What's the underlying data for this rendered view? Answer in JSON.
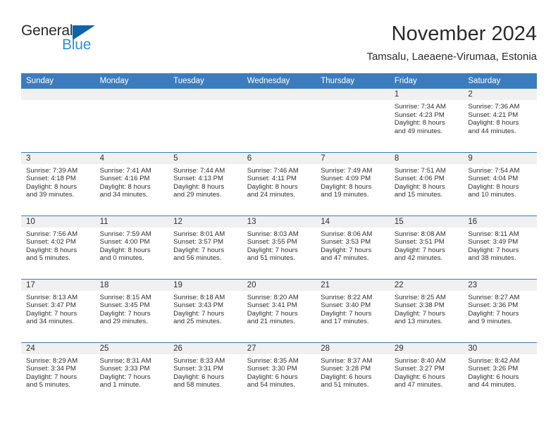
{
  "logo": {
    "word1": "General",
    "word2": "Blue",
    "triangle_color": "#0f64a8",
    "word2_color": "#2f8fd8"
  },
  "header": {
    "title": "November 2024",
    "subtitle": "Tamsalu, Laeaene-Virumaa, Estonia"
  },
  "theme": {
    "header_blue": "#3b7cbe",
    "band_gray": "#f0f0f0",
    "text": "#303030"
  },
  "calendar": {
    "weekday_headers": [
      "Sunday",
      "Monday",
      "Tuesday",
      "Wednesday",
      "Thursday",
      "Friday",
      "Saturday"
    ],
    "weeks": [
      [
        {
          "day": "",
          "empty": true,
          "sunrise": "",
          "sunset": "",
          "daylight1": "",
          "daylight2": ""
        },
        {
          "day": "",
          "empty": true,
          "sunrise": "",
          "sunset": "",
          "daylight1": "",
          "daylight2": ""
        },
        {
          "day": "",
          "empty": true,
          "sunrise": "",
          "sunset": "",
          "daylight1": "",
          "daylight2": ""
        },
        {
          "day": "",
          "empty": true,
          "sunrise": "",
          "sunset": "",
          "daylight1": "",
          "daylight2": ""
        },
        {
          "day": "",
          "empty": true,
          "sunrise": "",
          "sunset": "",
          "daylight1": "",
          "daylight2": ""
        },
        {
          "day": "1",
          "empty": false,
          "sunrise": "Sunrise: 7:34 AM",
          "sunset": "Sunset: 4:23 PM",
          "daylight1": "Daylight: 8 hours",
          "daylight2": "and 49 minutes."
        },
        {
          "day": "2",
          "empty": false,
          "sunrise": "Sunrise: 7:36 AM",
          "sunset": "Sunset: 4:21 PM",
          "daylight1": "Daylight: 8 hours",
          "daylight2": "and 44 minutes."
        }
      ],
      [
        {
          "day": "3",
          "empty": false,
          "sunrise": "Sunrise: 7:39 AM",
          "sunset": "Sunset: 4:18 PM",
          "daylight1": "Daylight: 8 hours",
          "daylight2": "and 39 minutes."
        },
        {
          "day": "4",
          "empty": false,
          "sunrise": "Sunrise: 7:41 AM",
          "sunset": "Sunset: 4:16 PM",
          "daylight1": "Daylight: 8 hours",
          "daylight2": "and 34 minutes."
        },
        {
          "day": "5",
          "empty": false,
          "sunrise": "Sunrise: 7:44 AM",
          "sunset": "Sunset: 4:13 PM",
          "daylight1": "Daylight: 8 hours",
          "daylight2": "and 29 minutes."
        },
        {
          "day": "6",
          "empty": false,
          "sunrise": "Sunrise: 7:46 AM",
          "sunset": "Sunset: 4:11 PM",
          "daylight1": "Daylight: 8 hours",
          "daylight2": "and 24 minutes."
        },
        {
          "day": "7",
          "empty": false,
          "sunrise": "Sunrise: 7:49 AM",
          "sunset": "Sunset: 4:09 PM",
          "daylight1": "Daylight: 8 hours",
          "daylight2": "and 19 minutes."
        },
        {
          "day": "8",
          "empty": false,
          "sunrise": "Sunrise: 7:51 AM",
          "sunset": "Sunset: 4:06 PM",
          "daylight1": "Daylight: 8 hours",
          "daylight2": "and 15 minutes."
        },
        {
          "day": "9",
          "empty": false,
          "sunrise": "Sunrise: 7:54 AM",
          "sunset": "Sunset: 4:04 PM",
          "daylight1": "Daylight: 8 hours",
          "daylight2": "and 10 minutes."
        }
      ],
      [
        {
          "day": "10",
          "empty": false,
          "sunrise": "Sunrise: 7:56 AM",
          "sunset": "Sunset: 4:02 PM",
          "daylight1": "Daylight: 8 hours",
          "daylight2": "and 5 minutes."
        },
        {
          "day": "11",
          "empty": false,
          "sunrise": "Sunrise: 7:59 AM",
          "sunset": "Sunset: 4:00 PM",
          "daylight1": "Daylight: 8 hours",
          "daylight2": "and 0 minutes."
        },
        {
          "day": "12",
          "empty": false,
          "sunrise": "Sunrise: 8:01 AM",
          "sunset": "Sunset: 3:57 PM",
          "daylight1": "Daylight: 7 hours",
          "daylight2": "and 56 minutes."
        },
        {
          "day": "13",
          "empty": false,
          "sunrise": "Sunrise: 8:03 AM",
          "sunset": "Sunset: 3:55 PM",
          "daylight1": "Daylight: 7 hours",
          "daylight2": "and 51 minutes."
        },
        {
          "day": "14",
          "empty": false,
          "sunrise": "Sunrise: 8:06 AM",
          "sunset": "Sunset: 3:53 PM",
          "daylight1": "Daylight: 7 hours",
          "daylight2": "and 47 minutes."
        },
        {
          "day": "15",
          "empty": false,
          "sunrise": "Sunrise: 8:08 AM",
          "sunset": "Sunset: 3:51 PM",
          "daylight1": "Daylight: 7 hours",
          "daylight2": "and 42 minutes."
        },
        {
          "day": "16",
          "empty": false,
          "sunrise": "Sunrise: 8:11 AM",
          "sunset": "Sunset: 3:49 PM",
          "daylight1": "Daylight: 7 hours",
          "daylight2": "and 38 minutes."
        }
      ],
      [
        {
          "day": "17",
          "empty": false,
          "sunrise": "Sunrise: 8:13 AM",
          "sunset": "Sunset: 3:47 PM",
          "daylight1": "Daylight: 7 hours",
          "daylight2": "and 34 minutes."
        },
        {
          "day": "18",
          "empty": false,
          "sunrise": "Sunrise: 8:15 AM",
          "sunset": "Sunset: 3:45 PM",
          "daylight1": "Daylight: 7 hours",
          "daylight2": "and 29 minutes."
        },
        {
          "day": "19",
          "empty": false,
          "sunrise": "Sunrise: 8:18 AM",
          "sunset": "Sunset: 3:43 PM",
          "daylight1": "Daylight: 7 hours",
          "daylight2": "and 25 minutes."
        },
        {
          "day": "20",
          "empty": false,
          "sunrise": "Sunrise: 8:20 AM",
          "sunset": "Sunset: 3:41 PM",
          "daylight1": "Daylight: 7 hours",
          "daylight2": "and 21 minutes."
        },
        {
          "day": "21",
          "empty": false,
          "sunrise": "Sunrise: 8:22 AM",
          "sunset": "Sunset: 3:40 PM",
          "daylight1": "Daylight: 7 hours",
          "daylight2": "and 17 minutes."
        },
        {
          "day": "22",
          "empty": false,
          "sunrise": "Sunrise: 8:25 AM",
          "sunset": "Sunset: 3:38 PM",
          "daylight1": "Daylight: 7 hours",
          "daylight2": "and 13 minutes."
        },
        {
          "day": "23",
          "empty": false,
          "sunrise": "Sunrise: 8:27 AM",
          "sunset": "Sunset: 3:36 PM",
          "daylight1": "Daylight: 7 hours",
          "daylight2": "and 9 minutes."
        }
      ],
      [
        {
          "day": "24",
          "empty": false,
          "sunrise": "Sunrise: 8:29 AM",
          "sunset": "Sunset: 3:34 PM",
          "daylight1": "Daylight: 7 hours",
          "daylight2": "and 5 minutes."
        },
        {
          "day": "25",
          "empty": false,
          "sunrise": "Sunrise: 8:31 AM",
          "sunset": "Sunset: 3:33 PM",
          "daylight1": "Daylight: 7 hours",
          "daylight2": "and 1 minute."
        },
        {
          "day": "26",
          "empty": false,
          "sunrise": "Sunrise: 8:33 AM",
          "sunset": "Sunset: 3:31 PM",
          "daylight1": "Daylight: 6 hours",
          "daylight2": "and 58 minutes."
        },
        {
          "day": "27",
          "empty": false,
          "sunrise": "Sunrise: 8:35 AM",
          "sunset": "Sunset: 3:30 PM",
          "daylight1": "Daylight: 6 hours",
          "daylight2": "and 54 minutes."
        },
        {
          "day": "28",
          "empty": false,
          "sunrise": "Sunrise: 8:37 AM",
          "sunset": "Sunset: 3:28 PM",
          "daylight1": "Daylight: 6 hours",
          "daylight2": "and 51 minutes."
        },
        {
          "day": "29",
          "empty": false,
          "sunrise": "Sunrise: 8:40 AM",
          "sunset": "Sunset: 3:27 PM",
          "daylight1": "Daylight: 6 hours",
          "daylight2": "and 47 minutes."
        },
        {
          "day": "30",
          "empty": false,
          "sunrise": "Sunrise: 8:42 AM",
          "sunset": "Sunset: 3:26 PM",
          "daylight1": "Daylight: 6 hours",
          "daylight2": "and 44 minutes."
        }
      ]
    ]
  }
}
